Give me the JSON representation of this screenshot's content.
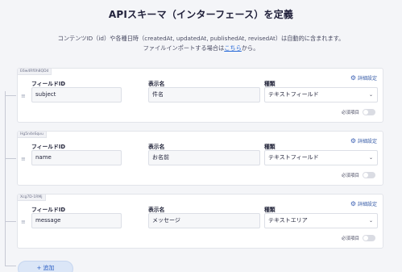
{
  "header": {
    "title": "APIスキーマ（インターフェース）を定義",
    "desc_line1": "コンテンツID（id）や各種日時（createdAt, updatedAt, publishedAt, revisedAt）は自動的に含まれます。",
    "desc_line2_pre": "ファイルインポートする場合は",
    "desc_link": "こちら",
    "desc_line2_post": "から。"
  },
  "labels": {
    "field_id": "フィールドID",
    "display_name": "表示名",
    "type": "種類",
    "settings": "詳細設定",
    "required": "必須項目",
    "add": "+ 追加"
  },
  "fields": [
    {
      "key": "E6w4Rf0h8QDd",
      "field_id": "subject",
      "display_name": "件名",
      "type": "テキストフィールド",
      "required": false
    },
    {
      "key": "Hg5n4eSqvu",
      "field_id": "name",
      "display_name": "お名前",
      "type": "テキストフィールド",
      "required": false
    },
    {
      "key": "Xcg7D-1RMj",
      "field_id": "message",
      "display_name": "メッセージ",
      "type": "テキストエリア",
      "required": false
    }
  ],
  "icons": {
    "settings": "gear-icon",
    "select": "chevron-down-icon",
    "drag": "drag-handle-icon"
  },
  "colors": {
    "accent": "#2b6cd9",
    "background": "#f4f5f8"
  }
}
